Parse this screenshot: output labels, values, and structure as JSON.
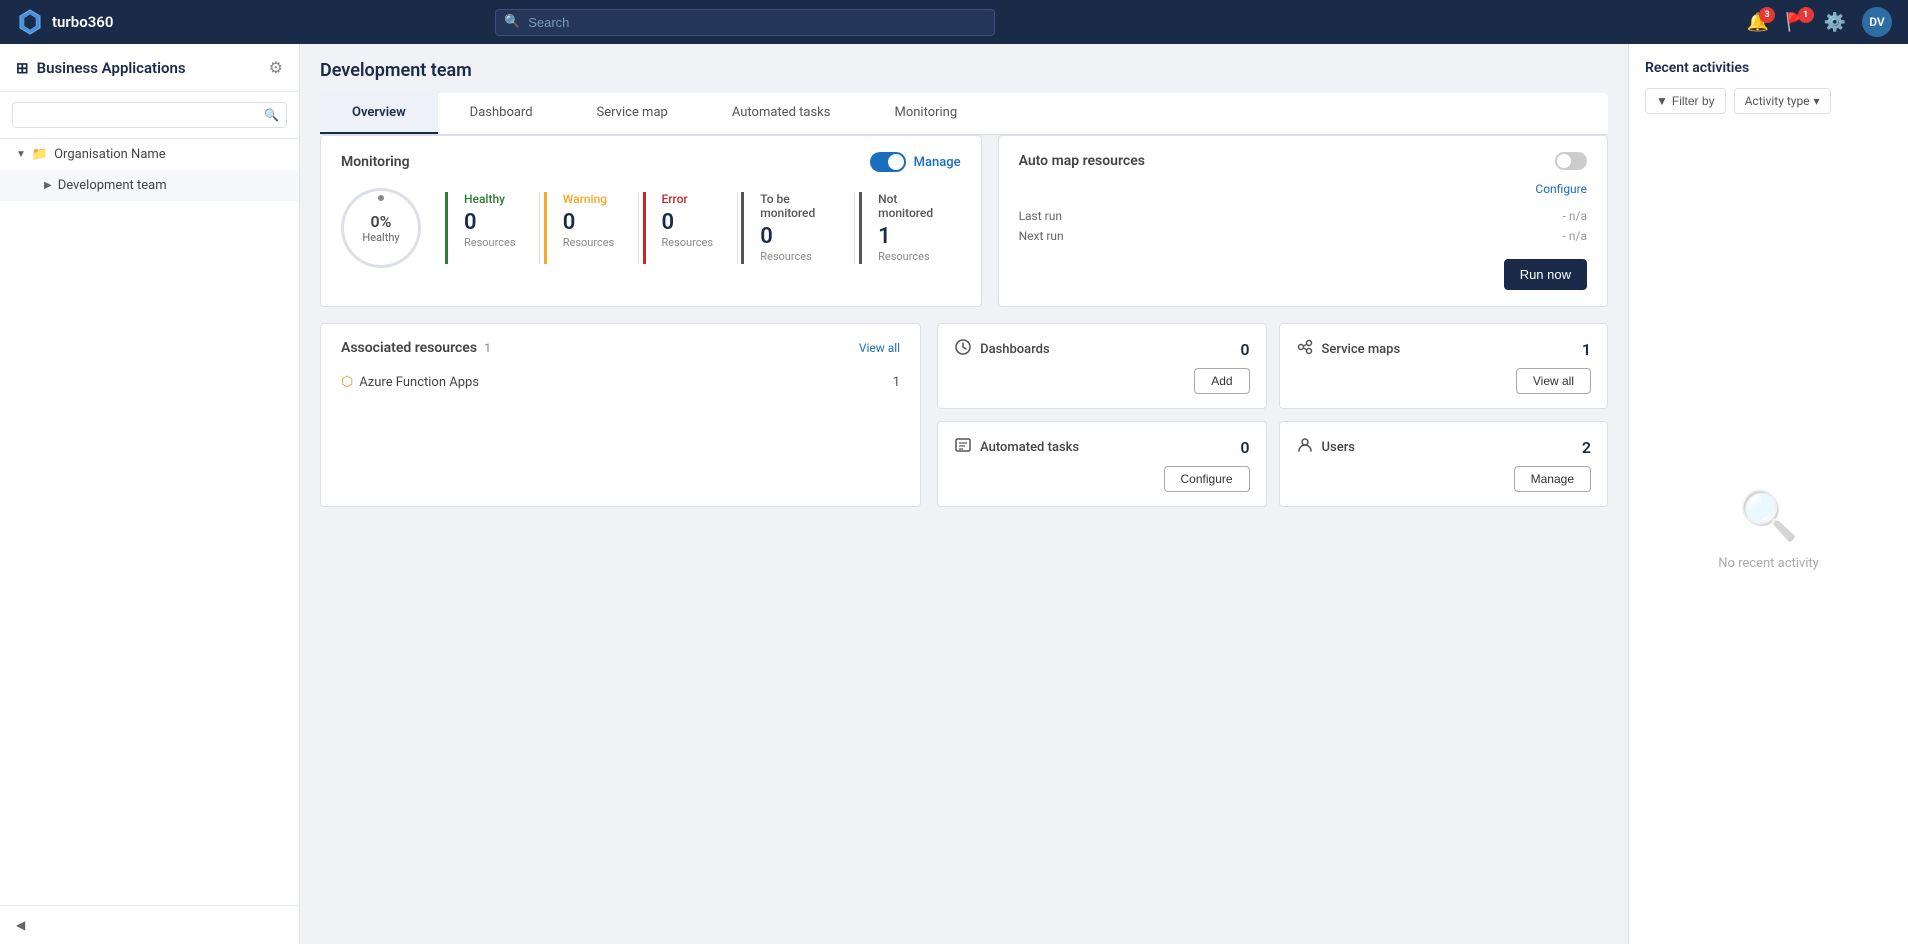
{
  "app": {
    "name": "turbo360",
    "logo_alt": "turbo360 logo"
  },
  "topnav": {
    "search_placeholder": "Search",
    "notifications_count": "3",
    "alerts_count": "1",
    "avatar_label": "DV"
  },
  "sidebar": {
    "title": "Business Applications",
    "search_placeholder": "",
    "org_name": "Organisation Name",
    "tree_items": [
      {
        "label": "Development team",
        "type": "child",
        "selected": true
      }
    ]
  },
  "page": {
    "title": "Development team",
    "tabs": [
      {
        "label": "Overview",
        "active": true
      },
      {
        "label": "Dashboard",
        "active": false
      },
      {
        "label": "Service map",
        "active": false
      },
      {
        "label": "Automated tasks",
        "active": false
      },
      {
        "label": "Monitoring",
        "active": false
      }
    ]
  },
  "monitoring": {
    "title": "Monitoring",
    "manage_label": "Manage",
    "toggle_on": true,
    "health_percent": "0%",
    "health_label": "Healthy",
    "stats": [
      {
        "label": "Healthy",
        "type": "healthy",
        "value": "0",
        "sub": "Resources"
      },
      {
        "label": "Warning",
        "type": "warning",
        "value": "0",
        "sub": "Resources"
      },
      {
        "label": "Error",
        "type": "error",
        "value": "0",
        "sub": "Resources"
      },
      {
        "label": "To be monitored",
        "type": "monitored",
        "value": "0",
        "sub": "Resources"
      },
      {
        "label": "Not monitored",
        "type": "not-monitored",
        "value": "1",
        "sub": "Resources"
      }
    ]
  },
  "automap": {
    "title": "Auto map resources",
    "toggle_on": false,
    "configure_label": "Configure",
    "last_run_label": "Last run",
    "last_run_value": "- n/a",
    "next_run_label": "Next run",
    "next_run_value": "- n/a",
    "run_now_label": "Run now"
  },
  "associated": {
    "title": "Associated resources",
    "count": "1",
    "view_all_label": "View all",
    "items": [
      {
        "label": "Azure Function Apps",
        "value": "1"
      }
    ]
  },
  "grid_cards": [
    {
      "id": "dashboards",
      "icon": "📊",
      "title": "Dashboards",
      "count": "0",
      "btn_label": "Add"
    },
    {
      "id": "service-maps",
      "icon": "🔗",
      "title": "Service maps",
      "count": "1",
      "btn_label": "View all"
    },
    {
      "id": "automated-tasks",
      "icon": "📋",
      "title": "Automated tasks",
      "count": "0",
      "btn_label": "Configure"
    },
    {
      "id": "users",
      "icon": "👤",
      "title": "Users",
      "count": "2",
      "btn_label": "Manage"
    }
  ],
  "recent": {
    "title": "Recent activities",
    "filter_label": "Filter by",
    "activity_type_label": "Activity type",
    "no_activity_label": "No recent activity"
  }
}
